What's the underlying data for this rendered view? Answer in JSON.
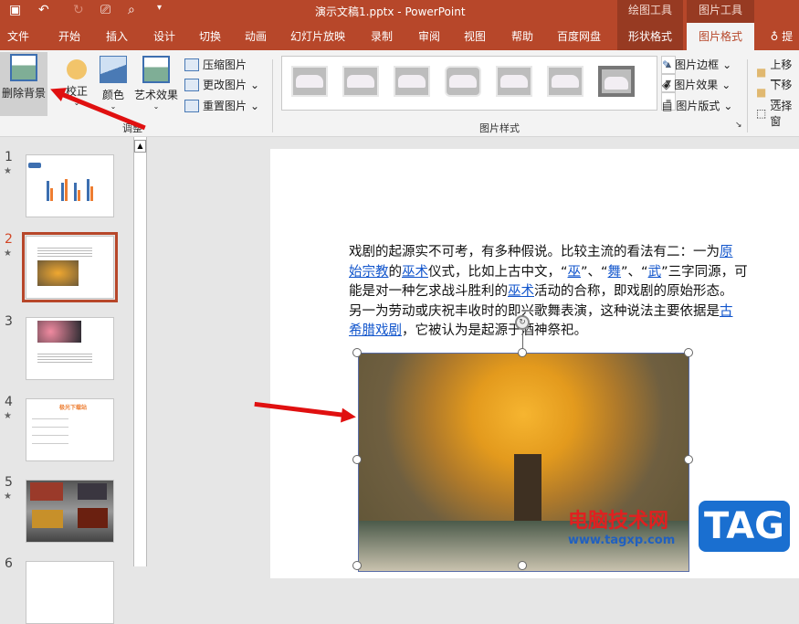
{
  "titlebar": {
    "title": "演示文稿1.pptx  -  PowerPoint",
    "context_drawing": "绘图工具",
    "context_picture": "图片工具",
    "quick_access": [
      "save-icon",
      "undo-icon",
      "redo-icon",
      "slideshow-icon",
      "preview-icon",
      "customize-icon"
    ]
  },
  "tabs": [
    "文件",
    "开始",
    "插入",
    "设计",
    "切换",
    "动画",
    "幻灯片放映",
    "录制",
    "审阅",
    "视图",
    "帮助",
    "百度网盘",
    "形状格式",
    "图片格式",
    "提"
  ],
  "ribbon": {
    "remove_bg": "删除背景",
    "corrections": "校正",
    "color": "颜色",
    "artistic": "艺术效果",
    "compress": "压缩图片",
    "change": "更改图片",
    "reset": "重置图片",
    "group_adjust": "调整",
    "group_styles": "图片样式",
    "border": "图片边框",
    "effects": "图片效果",
    "layout": "图片版式",
    "bring_forward": "上移一",
    "send_backward": "下移一",
    "selection": "选择窗"
  },
  "slides": [
    {
      "num": "1",
      "star": "★"
    },
    {
      "num": "2",
      "star": "★"
    },
    {
      "num": "3"
    },
    {
      "num": "4",
      "star": "★"
    },
    {
      "num": "5",
      "star": "★"
    },
    {
      "num": "6"
    }
  ],
  "slide4_title": "极光下载站",
  "paragraph": [
    [
      {
        "t": "戏剧的起源实不可考，有多种假说。比较主流的看法有二：一为"
      },
      {
        "t": "原",
        "link": true
      }
    ],
    [
      {
        "t": "始宗教",
        "link": true
      },
      {
        "t": "的"
      },
      {
        "t": "巫术",
        "link": true
      },
      {
        "t": "仪式，比如上古中文，“"
      },
      {
        "t": "巫",
        "link": true
      },
      {
        "t": "”、“"
      },
      {
        "t": "舞",
        "link": true
      },
      {
        "t": "”、“"
      },
      {
        "t": "武",
        "link": true
      },
      {
        "t": "”三字同源，可"
      }
    ],
    [
      {
        "t": "能是对一种乞求战斗胜利的"
      },
      {
        "t": "巫术",
        "link": true
      },
      {
        "t": "活动的合称，即戏剧的原始形态。"
      }
    ],
    [
      {
        "t": "另一为劳动或庆祝丰收时的即兴歌舞表演，这种说法主要依据是"
      },
      {
        "t": "古",
        "link": true
      }
    ],
    [
      {
        "t": "希腊戏剧",
        "link": true
      },
      {
        "t": "，它被认为是起源于酒神祭祀。"
      }
    ]
  ],
  "watermark": {
    "cn": "电脑技术网",
    "url": "www.tagxp.com",
    "logo": "TAG"
  }
}
